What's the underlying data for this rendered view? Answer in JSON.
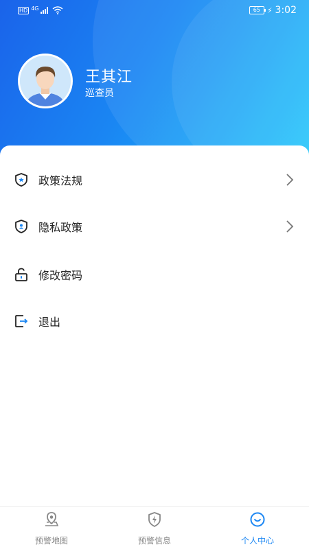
{
  "status_bar": {
    "hd": "HD",
    "network": "4G",
    "battery": "65",
    "charging_icon": "lightning-icon",
    "time": "3:02"
  },
  "profile": {
    "name": "王其江",
    "role": "巡查员"
  },
  "menu": [
    {
      "label": "政策法规",
      "icon": "shield-star-icon",
      "has_chevron": true
    },
    {
      "label": "隐私政策",
      "icon": "shield-user-icon",
      "has_chevron": true
    },
    {
      "label": "修改密码",
      "icon": "unlock-icon",
      "has_chevron": false
    },
    {
      "label": "退出",
      "icon": "logout-icon",
      "has_chevron": false
    }
  ],
  "tabs": [
    {
      "label": "预警地图",
      "icon": "map-pin-icon",
      "active": false
    },
    {
      "label": "预警信息",
      "icon": "shield-bolt-icon",
      "active": false
    },
    {
      "label": "个人中心",
      "icon": "smile-icon",
      "active": true
    }
  ],
  "colors": {
    "accent": "#1a86f3",
    "header_start": "#1a63ea",
    "header_end": "#1cc6fb",
    "text": "#222222",
    "tab_inactive": "#888888"
  }
}
